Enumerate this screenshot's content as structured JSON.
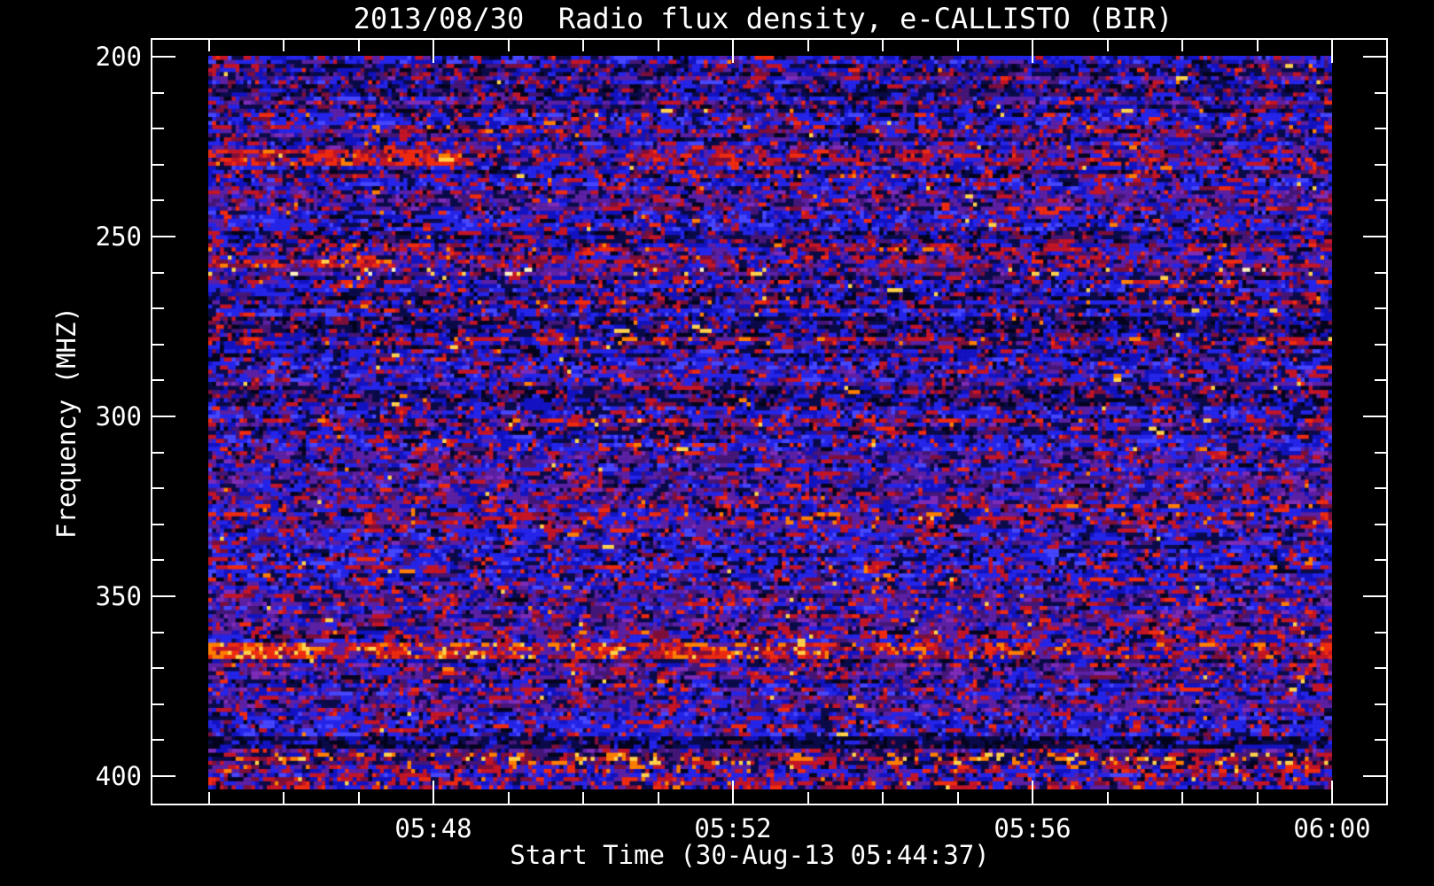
{
  "window": {
    "background": "#000000",
    "foreground": "#ffffff"
  },
  "chart_data": {
    "type": "heatmap",
    "title": "2013/08/30  Radio flux density, e-CALLISTO (BIR)",
    "subtitle": "",
    "legend": "none",
    "grid": "off",
    "x_axis": {
      "label": "Start Time (30-Aug-13 05:44:37)",
      "start_time": "05:44:37",
      "major_ticks": [
        "05:48",
        "05:52",
        "05:56",
        "06:00"
      ],
      "minor_ticks": [
        "05:45",
        "05:46",
        "05:47",
        "05:49",
        "05:50",
        "05:51",
        "05:53",
        "05:54",
        "05:55",
        "05:57",
        "05:58",
        "05:59"
      ],
      "data_start": "05:45",
      "data_end": "06:00"
    },
    "y_axis": {
      "label": "Frequency (MHZ)",
      "major_ticks": [
        200,
        250,
        300,
        350,
        400
      ],
      "major_tick_labels": [
        "200",
        "250",
        "300",
        "350",
        "400"
      ],
      "minor_tick_step": 10,
      "data_range": [
        199.8,
        403.7
      ],
      "inverted": true
    },
    "features": [
      {
        "type": "red_streak",
        "freq_lo": 226.0,
        "freq_hi": 230.0,
        "strong_frac": 0.23,
        "note": "faint red emission streak ~228 MHz, strongest near 05:46-05:48"
      },
      {
        "type": "red_streak",
        "freq_lo": 256.0,
        "freq_hi": 258.5,
        "strong_frac": 0.16,
        "note": "red interference streak ~257 MHz on left side"
      },
      {
        "type": "speckle_yellow",
        "freq_lo": 258.5,
        "freq_hi": 261.5,
        "note": "channel with bright yellow speckles across full duration ~260 MHz"
      },
      {
        "type": "orange_band",
        "freq_lo": 363.0,
        "freq_hi": 367.0,
        "note": "bright orange interference band ~365 MHz, saturated at left edge"
      },
      {
        "type": "dark_band",
        "freq_lo": 389.5,
        "freq_hi": 392.8,
        "note": "dark low-signal channel band ~391 MHz"
      },
      {
        "type": "orange_speckle",
        "freq_lo": 393.2,
        "freq_hi": 397.0,
        "note": "channel with bright orange dashes ~395 MHz"
      }
    ],
    "palette": {
      "blue_bright": "#2525ea",
      "blue_mid": "#1313c2",
      "blue_light": "#4646ff",
      "navy": "#0b0b4a",
      "near_black": "#04041e",
      "purple": "#5c20a4",
      "purple_dark": "#451678",
      "purple_light": "#7e2cb8",
      "red": "#c41527",
      "red_bright": "#ef2b10",
      "maroon": "#7e0f3a",
      "orange": "#ff7f00",
      "yellow": "#ffd24a",
      "cream": "#fff2c0",
      "axis": "#ffffff",
      "background": "#000000"
    },
    "noise": {
      "seed": 20130830,
      "cols": 288,
      "rows": 180,
      "run_copy_prob": 0.28,
      "profile_weights": [
        0.38,
        0.3,
        0.16,
        0.16
      ],
      "profiles": {
        "blue": [
          [
            "blue_bright",
            30
          ],
          [
            "blue_mid",
            16
          ],
          [
            "blue_light",
            10
          ],
          [
            "navy",
            12
          ],
          [
            "purple",
            8
          ],
          [
            "purple_dark",
            6
          ],
          [
            "red",
            9
          ],
          [
            "red_bright",
            3
          ],
          [
            "near_black",
            4
          ],
          [
            "maroon",
            2
          ]
        ],
        "purple": [
          [
            "purple",
            24
          ],
          [
            "purple_dark",
            16
          ],
          [
            "purple_light",
            7
          ],
          [
            "blue_mid",
            12
          ],
          [
            "blue_bright",
            10
          ],
          [
            "navy",
            12
          ],
          [
            "red",
            10
          ],
          [
            "maroon",
            5
          ],
          [
            "red_bright",
            2
          ],
          [
            "near_black",
            2
          ]
        ],
        "dark": [
          [
            "navy",
            26
          ],
          [
            "near_black",
            14
          ],
          [
            "blue_mid",
            18
          ],
          [
            "blue_bright",
            10
          ],
          [
            "purple_dark",
            14
          ],
          [
            "maroon",
            8
          ],
          [
            "red",
            8
          ],
          [
            "purple",
            2
          ]
        ],
        "redmix": [
          [
            "red",
            18
          ],
          [
            "red_bright",
            7
          ],
          [
            "maroon",
            10
          ],
          [
            "purple",
            18
          ],
          [
            "blue_bright",
            16
          ],
          [
            "blue_mid",
            12
          ],
          [
            "navy",
            12
          ],
          [
            "orange",
            3
          ],
          [
            "near_black",
            4
          ]
        ]
      },
      "feature_tables": {
        "red_strong": [
          [
            "red_bright",
            30
          ],
          [
            "red",
            28
          ],
          [
            "orange",
            8
          ],
          [
            "maroon",
            12
          ],
          [
            "purple",
            10
          ],
          [
            "navy",
            6
          ],
          [
            "yellow",
            2
          ],
          [
            "blue_bright",
            4
          ]
        ],
        "red_weak": [
          [
            "red",
            20
          ],
          [
            "maroon",
            12
          ],
          [
            "purple",
            24
          ],
          [
            "blue_mid",
            14
          ],
          [
            "blue_bright",
            12
          ],
          [
            "navy",
            10
          ],
          [
            "red_bright",
            6
          ],
          [
            "near_black",
            2
          ]
        ],
        "orange_z1": [
          [
            "orange",
            34
          ],
          [
            "yellow",
            22
          ],
          [
            "red_bright",
            22
          ],
          [
            "red",
            14
          ],
          [
            "maroon",
            4
          ],
          [
            "purple",
            4
          ]
        ],
        "orange_z2": [
          [
            "red_bright",
            22
          ],
          [
            "orange",
            14
          ],
          [
            "red",
            24
          ],
          [
            "maroon",
            12
          ],
          [
            "purple",
            14
          ],
          [
            "yellow",
            6
          ],
          [
            "blue_mid",
            8
          ]
        ],
        "orange_z3": [
          [
            "red",
            22
          ],
          [
            "red_bright",
            10
          ],
          [
            "orange",
            6
          ],
          [
            "purple",
            24
          ],
          [
            "maroon",
            14
          ],
          [
            "blue_mid",
            12
          ],
          [
            "navy",
            8
          ],
          [
            "blue_bright",
            4
          ]
        ],
        "dark_band": [
          [
            "near_black",
            34
          ],
          [
            "navy",
            30
          ],
          [
            "blue_mid",
            14
          ],
          [
            "maroon",
            8
          ],
          [
            "blue_bright",
            8
          ],
          [
            "purple_dark",
            6
          ]
        ],
        "orange_speckle": [
          [
            "navy",
            18
          ],
          [
            "purple_dark",
            18
          ],
          [
            "maroon",
            12
          ],
          [
            "red",
            14
          ],
          [
            "blue_mid",
            12
          ],
          [
            "orange",
            10
          ],
          [
            "yellow",
            8
          ],
          [
            "near_black",
            4
          ],
          [
            "purple",
            4
          ]
        ]
      }
    }
  }
}
